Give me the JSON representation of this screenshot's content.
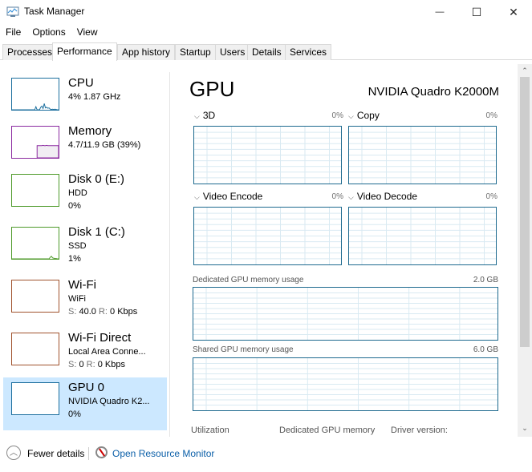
{
  "window": {
    "title": "Task Manager",
    "minimize": "—",
    "maximize": "☐",
    "close": "✕"
  },
  "menu": [
    "File",
    "Options",
    "View"
  ],
  "tabs": [
    "Processes",
    "Performance",
    "App history",
    "Startup",
    "Users",
    "Details",
    "Services"
  ],
  "active_tab": "Performance",
  "sidebar": [
    {
      "name": "CPU",
      "line2": "4%  1.87 GHz",
      "line3": "",
      "color": "#1c6f9e"
    },
    {
      "name": "Memory",
      "line2": "4.7/11.9 GB (39%)",
      "line3": "",
      "color": "#8b2aa0"
    },
    {
      "name": "Disk 0 (E:)",
      "line2": "HDD",
      "line3": "0%",
      "color": "#4e9a2a"
    },
    {
      "name": "Disk 1 (C:)",
      "line2": "SSD",
      "line3": "1%",
      "color": "#4e9a2a"
    },
    {
      "name": "Wi-Fi",
      "line2": "WiFi",
      "line3_s": "S:",
      "line3_sv": "40.0",
      "line3_r": "R:",
      "line3_rv": "0 Kbps",
      "color": "#a0522d"
    },
    {
      "name": "Wi-Fi Direct",
      "line2": "Local Area Conne...",
      "line3_s": "S:",
      "line3_sv": "0",
      "line3_r": "R:",
      "line3_rv": "0 Kbps",
      "color": "#a0522d"
    },
    {
      "name": "GPU 0",
      "line2": "NVIDIA Quadro K2...",
      "line3": "0%",
      "color": "#1c6f9e",
      "selected": true
    }
  ],
  "main": {
    "title": "GPU",
    "model": "NVIDIA Quadro K2000M",
    "engines": [
      {
        "label": "3D",
        "pct": "0%"
      },
      {
        "label": "Copy",
        "pct": "0%"
      },
      {
        "label": "Video Encode",
        "pct": "0%"
      },
      {
        "label": "Video Decode",
        "pct": "0%"
      }
    ],
    "dedicated_label": "Dedicated GPU memory usage",
    "dedicated_value": "2.0 GB",
    "shared_label": "Shared GPU memory usage",
    "shared_value": "6.0 GB",
    "stats": [
      "Utilization",
      "Dedicated GPU memory",
      "Driver version:"
    ]
  },
  "footer": {
    "fewer_details": "Fewer details",
    "open_resmon": "Open Resource Monitor"
  },
  "chart_data": {
    "type": "line",
    "title": "GPU",
    "series": [
      {
        "name": "CPU",
        "values": [
          0,
          0,
          0,
          0,
          0,
          0,
          0,
          0,
          0,
          0,
          0,
          0,
          0,
          0,
          0,
          0,
          0,
          0,
          0,
          0,
          10,
          0,
          0,
          0,
          8,
          12,
          4,
          20,
          6,
          8,
          5,
          6,
          2,
          1,
          2,
          1,
          2,
          1,
          0,
          0
        ]
      },
      {
        "name": "Memory",
        "values": [
          0,
          0,
          0,
          0,
          0,
          0,
          0,
          0,
          0,
          0,
          0,
          0,
          0,
          0,
          0,
          0,
          0,
          0,
          0,
          0,
          0,
          39,
          39,
          39,
          39,
          39,
          40,
          39,
          39,
          40,
          39,
          39,
          39,
          39,
          39,
          39,
          39,
          39,
          39,
          39
        ]
      },
      {
        "name": "Disk 1 (C:)",
        "values": [
          0,
          0,
          0,
          0,
          0,
          0,
          0,
          0,
          0,
          0,
          0,
          0,
          0,
          0,
          0,
          0,
          0,
          0,
          0,
          0,
          0,
          0,
          0,
          0,
          0,
          0,
          0,
          0,
          0,
          0,
          0,
          0,
          5,
          8,
          3,
          2,
          1,
          1,
          0,
          0
        ]
      }
    ],
    "ylim": [
      0,
      100
    ]
  }
}
